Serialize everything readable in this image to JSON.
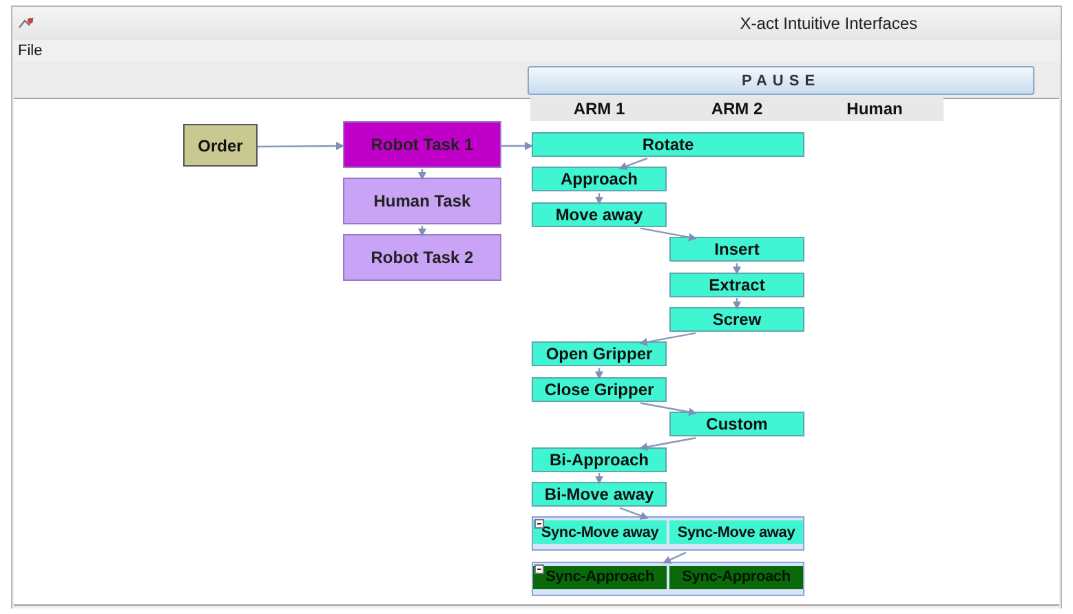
{
  "window": {
    "title": "X-act Intuitive Interfaces"
  },
  "menu": [
    "File"
  ],
  "pause_button": "PAUSE",
  "lanes": [
    "ARM 1",
    "ARM 2",
    "Human"
  ],
  "order": {
    "label": "Order",
    "color": "#c8c890"
  },
  "tasks": [
    {
      "label": "Robot Task 1",
      "color": "#c000c8"
    },
    {
      "label": "Human Task",
      "color": "#c9a3f5"
    },
    {
      "label": "Robot Task 2",
      "color": "#c9a3f5"
    }
  ],
  "arm_steps": [
    {
      "kind": "dual",
      "label": "Rotate",
      "color": "#40f5d2"
    },
    {
      "kind": "arm1",
      "label": "Approach",
      "color": "#40f5d2"
    },
    {
      "kind": "arm1",
      "label": "Move away",
      "color": "#40f5d2"
    },
    {
      "kind": "arm2",
      "label": "Insert",
      "color": "#40f5d2"
    },
    {
      "kind": "arm2",
      "label": "Extract",
      "color": "#40f5d2"
    },
    {
      "kind": "arm2",
      "label": "Screw",
      "color": "#40f5d2"
    },
    {
      "kind": "arm1",
      "label": "Open Gripper",
      "color": "#40f5d2"
    },
    {
      "kind": "arm1",
      "label": "Close Gripper",
      "color": "#40f5d2"
    },
    {
      "kind": "arm2",
      "label": "Custom",
      "color": "#40f5d2"
    },
    {
      "kind": "arm1",
      "label": "Bi-Approach",
      "color": "#40f5d2"
    },
    {
      "kind": "arm1",
      "label": "Bi-Move away",
      "color": "#40f5d2"
    },
    {
      "kind": "sync",
      "labels": [
        "Sync-Move away",
        "Sync-Move away"
      ],
      "color": "#40f5d2"
    },
    {
      "kind": "sync",
      "labels": [
        "Sync-Approach",
        "Sync-Approach"
      ],
      "color": "#0a6a0a"
    }
  ]
}
